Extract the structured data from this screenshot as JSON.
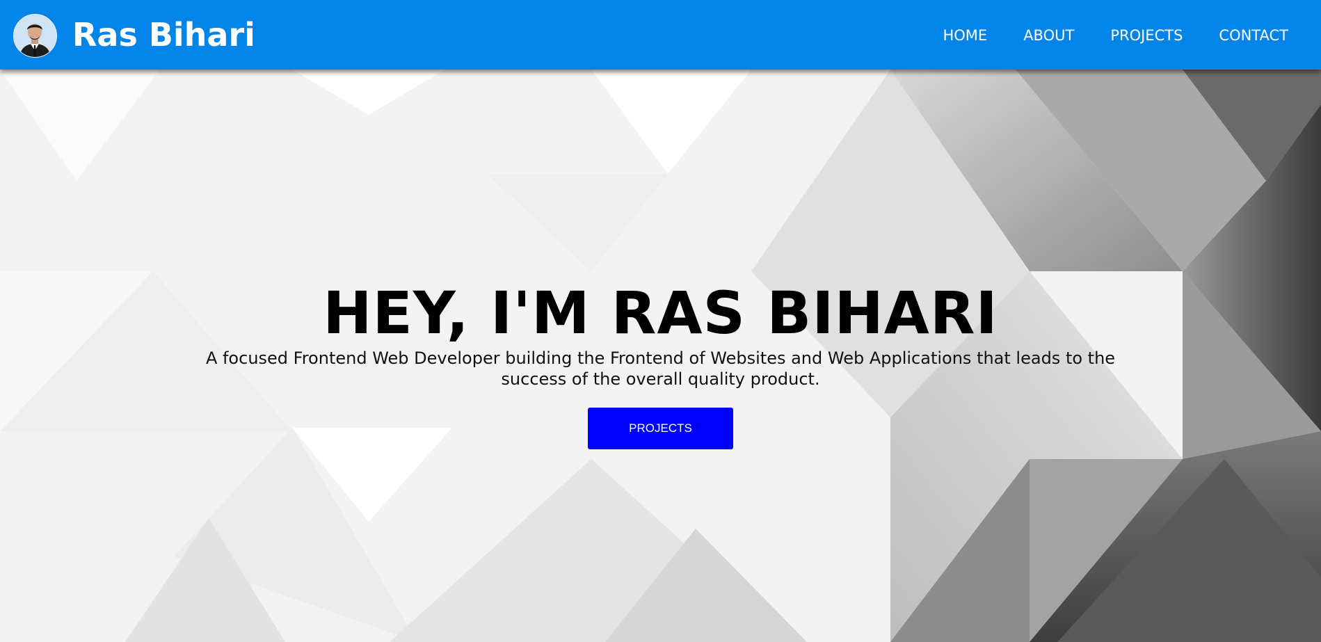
{
  "colors": {
    "navbar": "#0284e8",
    "brand_text": "#ffffff",
    "button": "#0000ff",
    "button_text": "#ffffff",
    "hero_title": "#000000"
  },
  "navbar": {
    "avatar_icon": "profile-photo",
    "brand": "Ras Bihari",
    "links": [
      "HOME",
      "ABOUT",
      "PROJECTS",
      "CONTACT"
    ]
  },
  "hero": {
    "title": "HEY, I'M RAS BIHARI",
    "subtitle": "A focused Frontend Web Developer building the Frontend of Websites and Web Applications that leads to the success of the overall quality product.",
    "button_label": "PROJECTS"
  }
}
